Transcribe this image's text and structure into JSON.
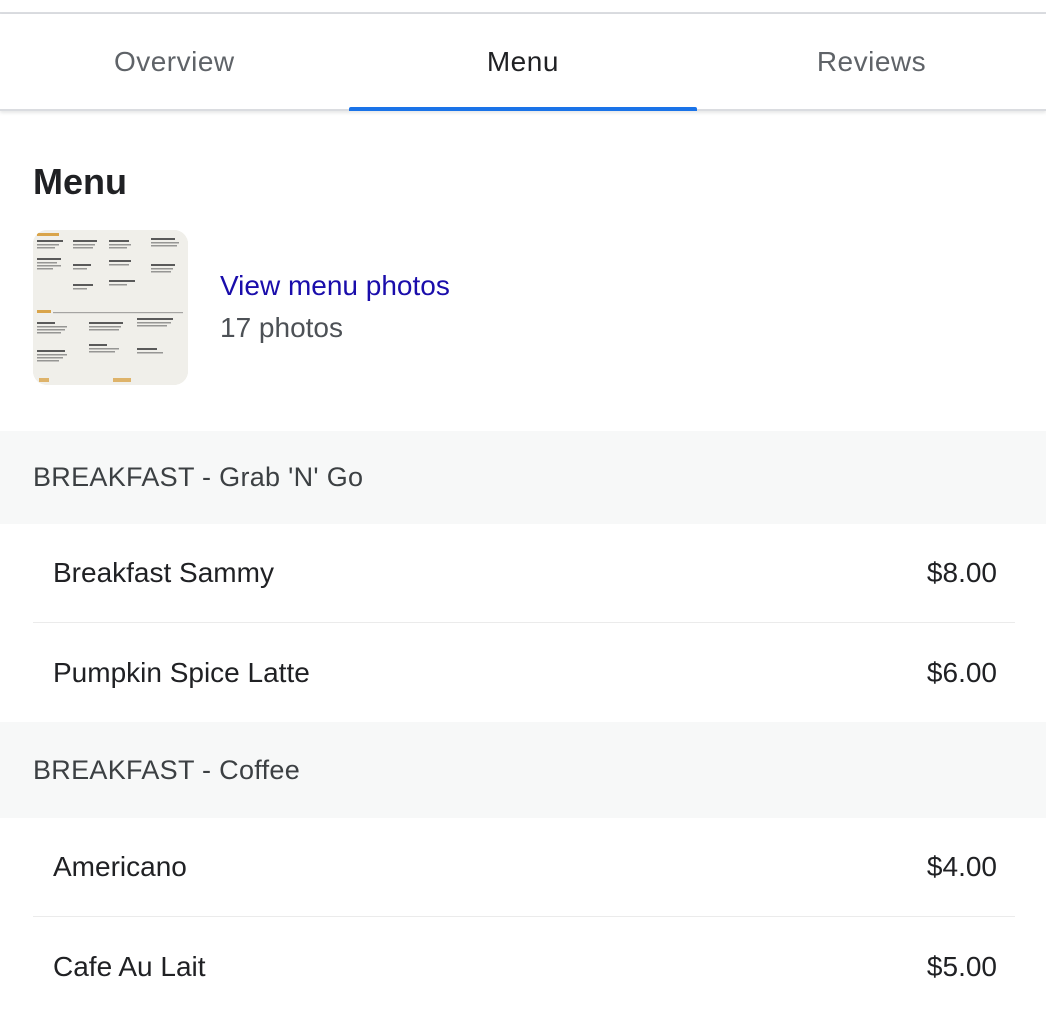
{
  "tabs": [
    {
      "label": "Overview",
      "active": false
    },
    {
      "label": "Menu",
      "active": true
    },
    {
      "label": "Reviews",
      "active": false
    }
  ],
  "colors": {
    "accent": "#1a73e8",
    "link": "#1a0dab",
    "section_bg": "#f7f8f8"
  },
  "menu": {
    "title": "Menu",
    "photos": {
      "thumbnail_icon": "menu-photo-thumbnail",
      "link_label": "View menu photos",
      "count_label": "17 photos"
    },
    "sections": [
      {
        "title": "BREAKFAST - Grab 'N' Go",
        "items": [
          {
            "name": "Breakfast Sammy",
            "price": "$8.00"
          },
          {
            "name": "Pumpkin Spice Latte",
            "price": "$6.00"
          }
        ]
      },
      {
        "title": "BREAKFAST - Coffee",
        "items": [
          {
            "name": "Americano",
            "price": "$4.00"
          },
          {
            "name": "Cafe Au Lait",
            "price": "$5.00"
          }
        ]
      }
    ]
  }
}
